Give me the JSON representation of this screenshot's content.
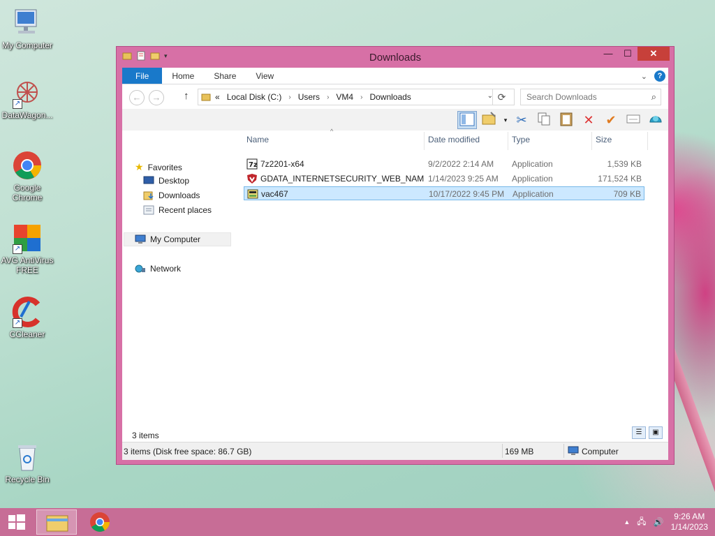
{
  "desktop": {
    "icons": [
      {
        "label": "My Computer"
      },
      {
        "label": "DataWagon..."
      },
      {
        "label": "Google Chrome"
      },
      {
        "label": "AVG AntiVirus FREE"
      },
      {
        "label": "CCleaner"
      },
      {
        "label": "Recycle Bin"
      }
    ]
  },
  "window": {
    "title": "Downloads",
    "ribbon_tabs": [
      "File",
      "Home",
      "Share",
      "View"
    ],
    "address": {
      "prefix": "«",
      "crumbs": [
        "Local Disk (C:)",
        "Users",
        "VM4",
        "Downloads"
      ]
    },
    "search_placeholder": "Search Downloads",
    "nav": {
      "favorites": "Favorites",
      "desktop": "Desktop",
      "downloads": "Downloads",
      "recent": "Recent places",
      "my_computer": "My Computer",
      "network": "Network"
    },
    "columns": {
      "name": "Name",
      "date": "Date modified",
      "type": "Type",
      "size": "Size"
    },
    "files": [
      {
        "name": "7z2201-x64",
        "date": "9/2/2022 2:14 AM",
        "type": "Application",
        "size": "1,539 KB"
      },
      {
        "name": "GDATA_INTERNETSECURITY_WEB_NAM",
        "date": "1/14/2023 9:25 AM",
        "type": "Application",
        "size": "171,524 KB"
      },
      {
        "name": "vac467",
        "date": "10/17/2022 9:45 PM",
        "type": "Application",
        "size": "709 KB"
      }
    ],
    "item_count": "3 items",
    "status": {
      "left": "3 items (Disk free space: 86.7 GB)",
      "size": "169 MB",
      "location": "Computer"
    }
  },
  "taskbar": {
    "time": "9:26 AM",
    "date": "1/14/2023"
  },
  "colors": {
    "window_frame": "#d770a6",
    "file_tab": "#1979ca",
    "taskbar": "#c76d96",
    "selection": "#cce8ff"
  }
}
